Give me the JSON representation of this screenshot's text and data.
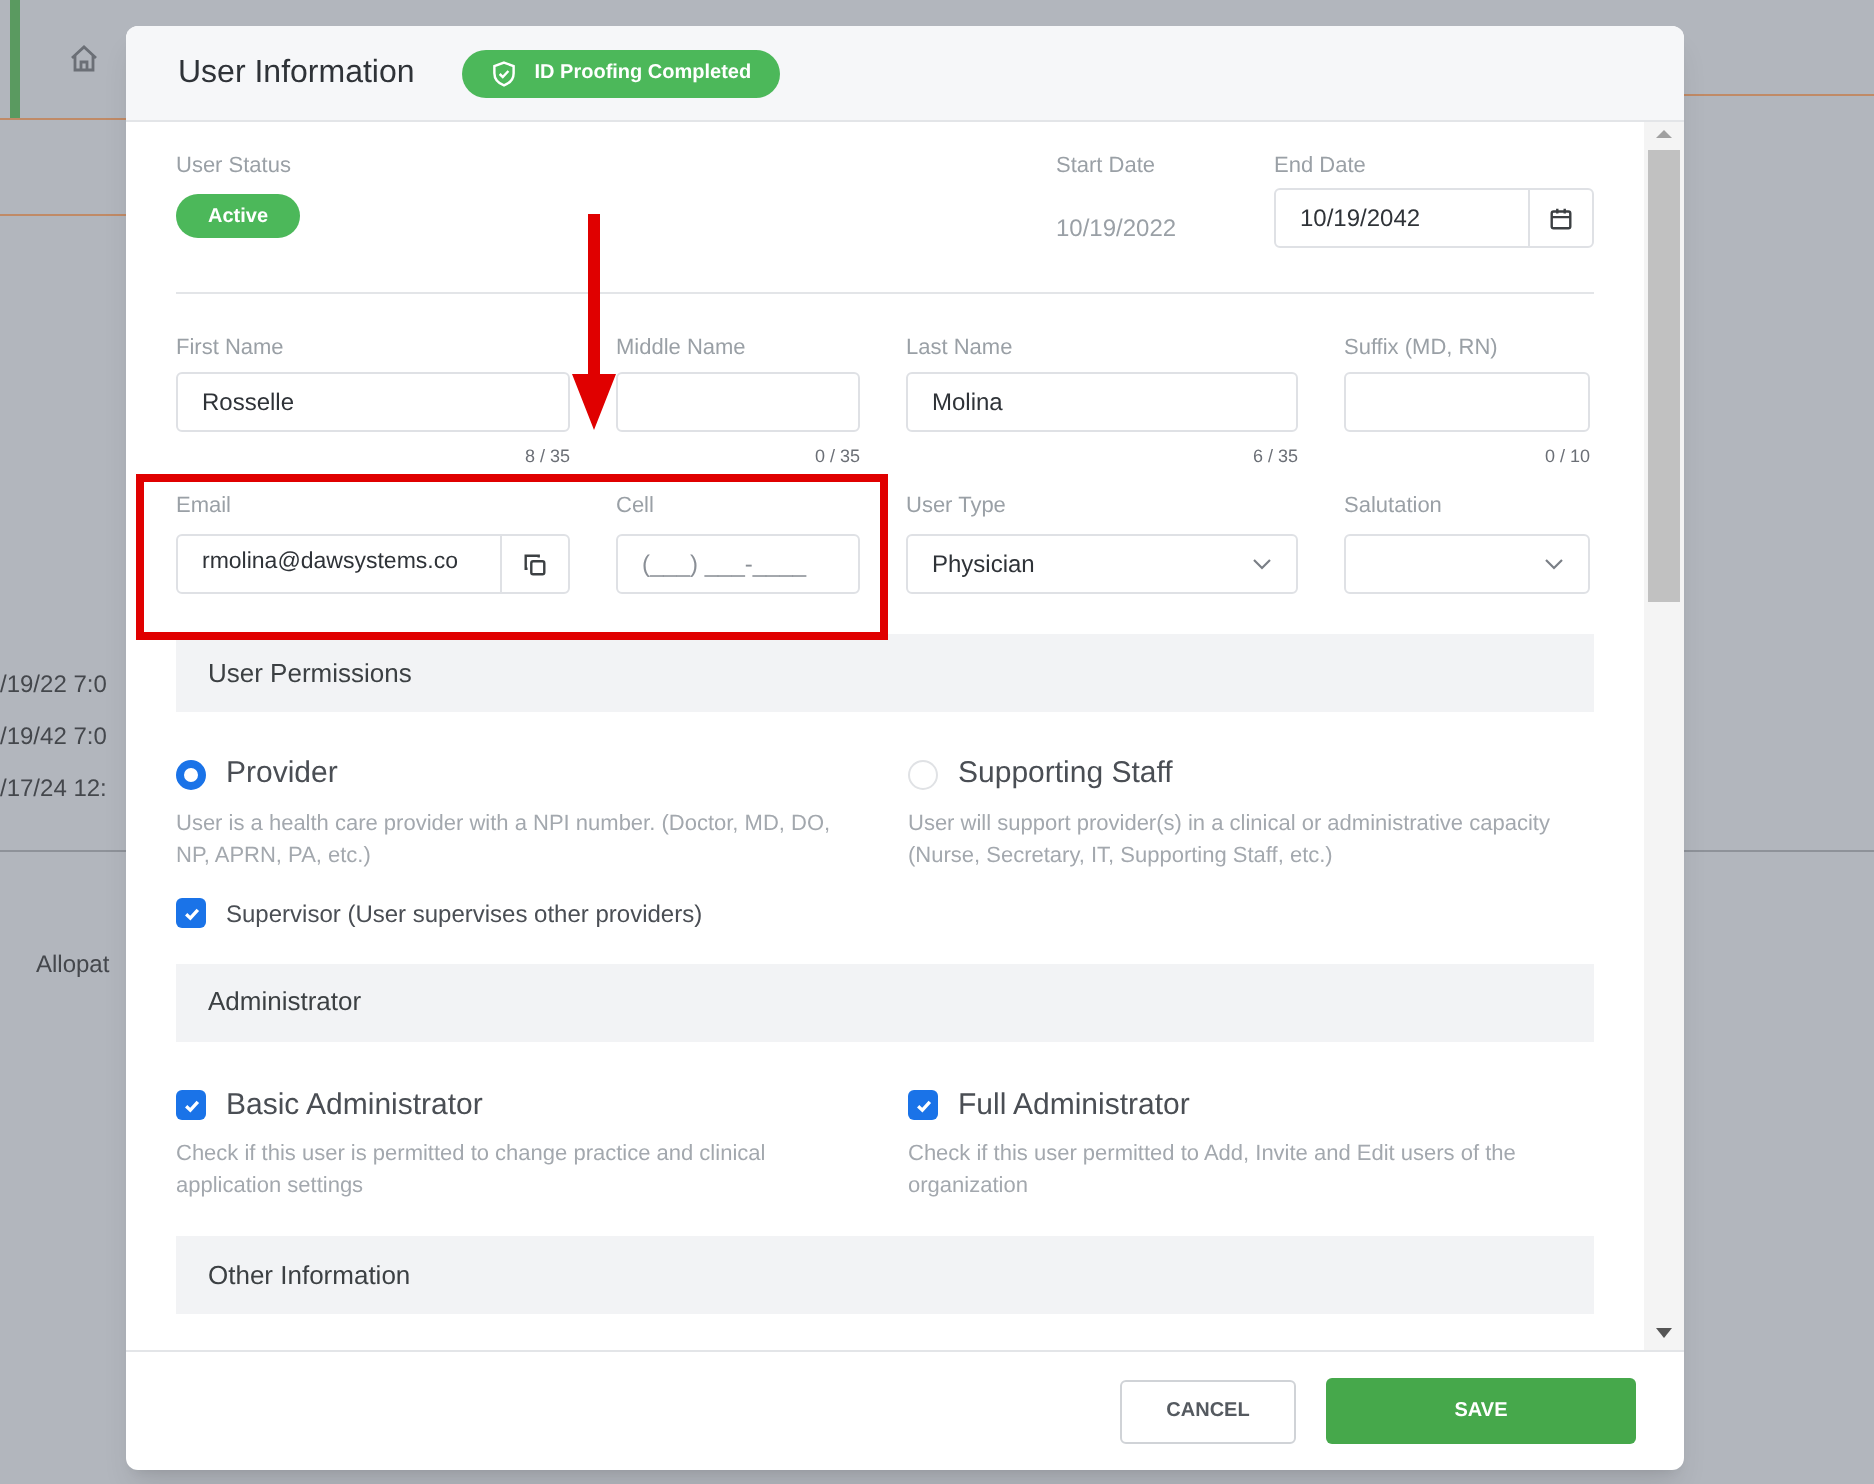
{
  "background": {
    "rows": [
      "/19/22 7:0",
      "/19/42 7:0",
      "/17/24 12:"
    ],
    "label": "Allopat"
  },
  "dialog": {
    "title": "User Information",
    "badge": "ID Proofing Completed"
  },
  "status": {
    "label": "User Status",
    "value": "Active",
    "start_label": "Start Date",
    "start_value": "10/19/2022",
    "end_label": "End Date",
    "end_value": "10/19/2042"
  },
  "name_fields": [
    {
      "label": "First Name",
      "value": "Rosselle",
      "counter": "8 / 35"
    },
    {
      "label": "Middle Name",
      "counter": "0 / 35"
    },
    {
      "label": "Last Name",
      "value": "Molina",
      "counter": "6 / 35"
    },
    {
      "label": "Suffix (MD, RN)",
      "counter": "0 / 10"
    }
  ],
  "contact_fields": [
    {
      "kind": "copy",
      "label": "Email",
      "value": "rmolina@dawsystems.co"
    },
    {
      "kind": "text",
      "label": "Cell",
      "placeholder": "(___) ___-____"
    },
    {
      "kind": "select",
      "label": "User Type",
      "value": "Physician"
    },
    {
      "kind": "select",
      "label": "Salutation"
    }
  ],
  "user_permissions": {
    "title": "User Permissions",
    "roles": [
      {
        "label": "Provider",
        "description": "User is a health care provider with a NPI number. (Doctor, MD, DO, NP, APRN, PA, etc.)",
        "selected": true
      },
      {
        "label": "Supporting Staff",
        "description": "User will support provider(s) in a clinical or administrative capacity (Nurse, Secretary, IT, Supporting Staff, etc.)",
        "selected": false
      }
    ],
    "supervisor": {
      "label": "Supervisor (User supervises other providers)",
      "checked": true
    }
  },
  "administrator": {
    "title": "Administrator",
    "options": [
      {
        "label": "Basic Administrator",
        "description": "Check if this user is permitted to change practice and clinical application settings",
        "checked": true
      },
      {
        "label": "Full Administrator",
        "description": "Check if this user permitted to Add, Invite and Edit users of the organization",
        "checked": true
      }
    ]
  },
  "other_information": {
    "title": "Other Information"
  },
  "buttons": [
    {
      "label": "CANCEL",
      "kind": "secondary"
    },
    {
      "label": "SAVE",
      "kind": "primary"
    }
  ]
}
